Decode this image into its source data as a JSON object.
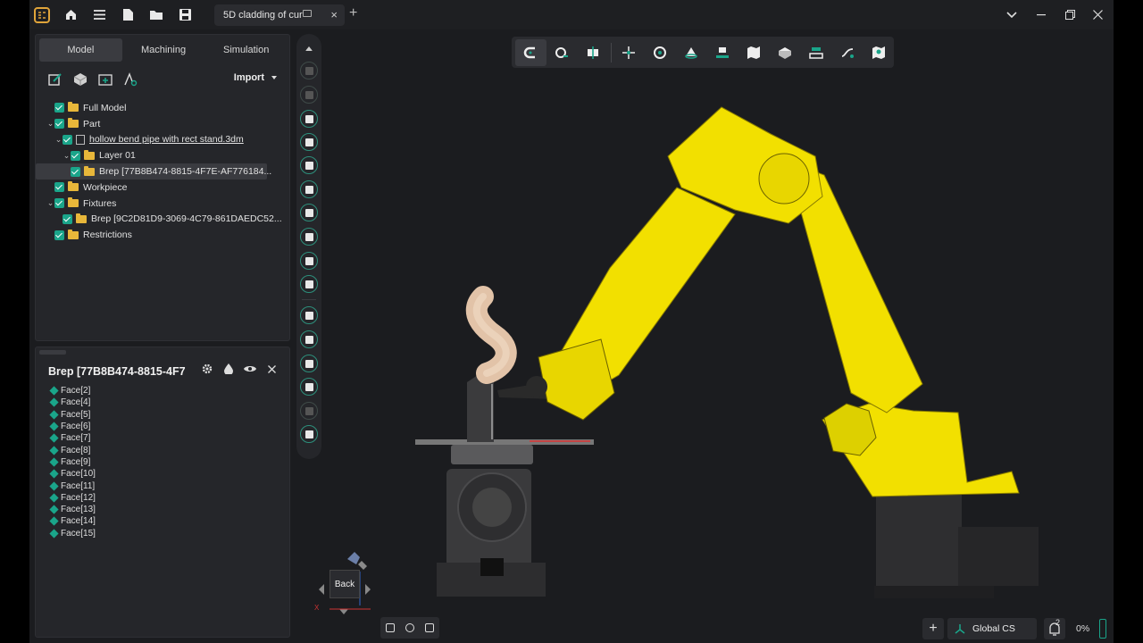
{
  "titlebar": {
    "tab_title": "5D cladding of cur",
    "new_tab": "+",
    "close_tab": "×"
  },
  "model_panel": {
    "tabs": [
      {
        "label": "Model",
        "active": true
      },
      {
        "label": "Machining",
        "active": false
      },
      {
        "label": "Simulation",
        "active": false
      }
    ],
    "import_label": "Import",
    "tree": [
      {
        "label": "Full Model",
        "level": 0
      },
      {
        "label": "Part",
        "level": 0
      },
      {
        "label": "hollow bend pipe with rect stand.3dm",
        "level": 1
      },
      {
        "label": "Layer 01",
        "level": 2
      },
      {
        "label": "Brep [77B8B474-8815-4F7E-AF776184...",
        "level": 3,
        "selected": true
      },
      {
        "label": "Workpiece",
        "level": 0
      },
      {
        "label": "Fixtures",
        "level": 0
      },
      {
        "label": "Brep [9C2D81D9-3069-4C79-861DAEDC52...",
        "level": 1
      },
      {
        "label": "Restrictions",
        "level": 0
      }
    ]
  },
  "props_panel": {
    "title": "Brep [77B8B474-8815-4F7",
    "faces": [
      "Face[2]",
      "Face[4]",
      "Face[5]",
      "Face[6]",
      "Face[7]",
      "Face[8]",
      "Face[9]",
      "Face[10]",
      "Face[11]",
      "Face[12]",
      "Face[13]",
      "Face[14]",
      "Face[15]"
    ]
  },
  "viewport": {
    "nav_cube_face": "Back",
    "axis_x": "X"
  },
  "status": {
    "coordinate_system": "Global CS",
    "notification_count": "2",
    "progress": "0%"
  },
  "colors": {
    "accent": "#1aa58a",
    "robot_yellow": "#f2e000",
    "background": "#1b1c1f"
  }
}
